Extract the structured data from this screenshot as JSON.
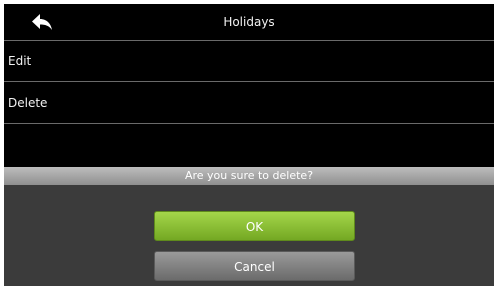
{
  "header": {
    "title": "Holidays",
    "back_icon": "back-arrow-icon"
  },
  "menu": {
    "items": [
      {
        "label": "Edit"
      },
      {
        "label": "Delete"
      }
    ]
  },
  "dialog": {
    "message": "Are you sure to delete?",
    "ok_label": "OK",
    "cancel_label": "Cancel"
  },
  "colors": {
    "background": "#000000",
    "ok_button": "#8cc63f",
    "cancel_button": "#808080",
    "dialog_background": "#3b3b3b"
  }
}
